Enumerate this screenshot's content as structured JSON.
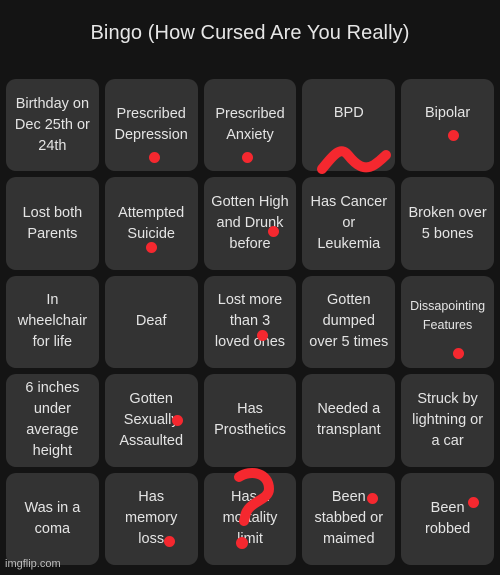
{
  "title": "Bingo (How Cursed Are You Really)",
  "watermark": "imgflip.com",
  "marker_color": "#f5282f",
  "cells": [
    {
      "label": "Birthday on\nDec 25th or\n24th",
      "marked": false
    },
    {
      "label": "Prescribed\nDepression",
      "marked": true,
      "mark": "dot"
    },
    {
      "label": "Prescribed\nAnxiety",
      "marked": true,
      "mark": "dot"
    },
    {
      "label": "BPD",
      "marked": true,
      "mark": "squiggle"
    },
    {
      "label": "Bipolar",
      "marked": true,
      "mark": "dot"
    },
    {
      "label": "Lost both\nParents",
      "marked": false
    },
    {
      "label": "Attempted\nSuicide",
      "marked": true,
      "mark": "dot"
    },
    {
      "label": "Gotten High\nand Drunk\nbefore",
      "marked": true,
      "mark": "dot"
    },
    {
      "label": "Has Cancer\nor\nLeukemia",
      "marked": false
    },
    {
      "label": "Broken over\n5 bones",
      "marked": false
    },
    {
      "label": "In\nwheelchair\nfor life",
      "marked": false
    },
    {
      "label": "Deaf",
      "marked": false
    },
    {
      "label": "Lost more\nthan 3\nloved ones",
      "marked": true,
      "mark": "dot"
    },
    {
      "label": "Gotten\ndumped\nover 5 times",
      "marked": false
    },
    {
      "label": "Dissapointing\nFeatures",
      "marked": true,
      "mark": "dot"
    },
    {
      "label": "6 inches\nunder\naverage\nheight",
      "marked": false
    },
    {
      "label": "Gotten\nSexually\nAssaulted",
      "marked": true,
      "mark": "dot"
    },
    {
      "label": "Has\nProsthetics",
      "marked": false
    },
    {
      "label": "Needed a\ntransplant",
      "marked": false
    },
    {
      "label": "Struck by\nlightning or\na car",
      "marked": false
    },
    {
      "label": "Was in a\ncoma",
      "marked": false
    },
    {
      "label": "Has\nmemory\nloss",
      "marked": true,
      "mark": "dot"
    },
    {
      "label": "Has a\nmortality\nlimit",
      "marked": true,
      "mark": "question-mark"
    },
    {
      "label": "Been\nstabbed or\nmaimed",
      "marked": true,
      "mark": "dot"
    },
    {
      "label": "Been\nrobbed",
      "marked": true,
      "mark": "dot"
    }
  ]
}
